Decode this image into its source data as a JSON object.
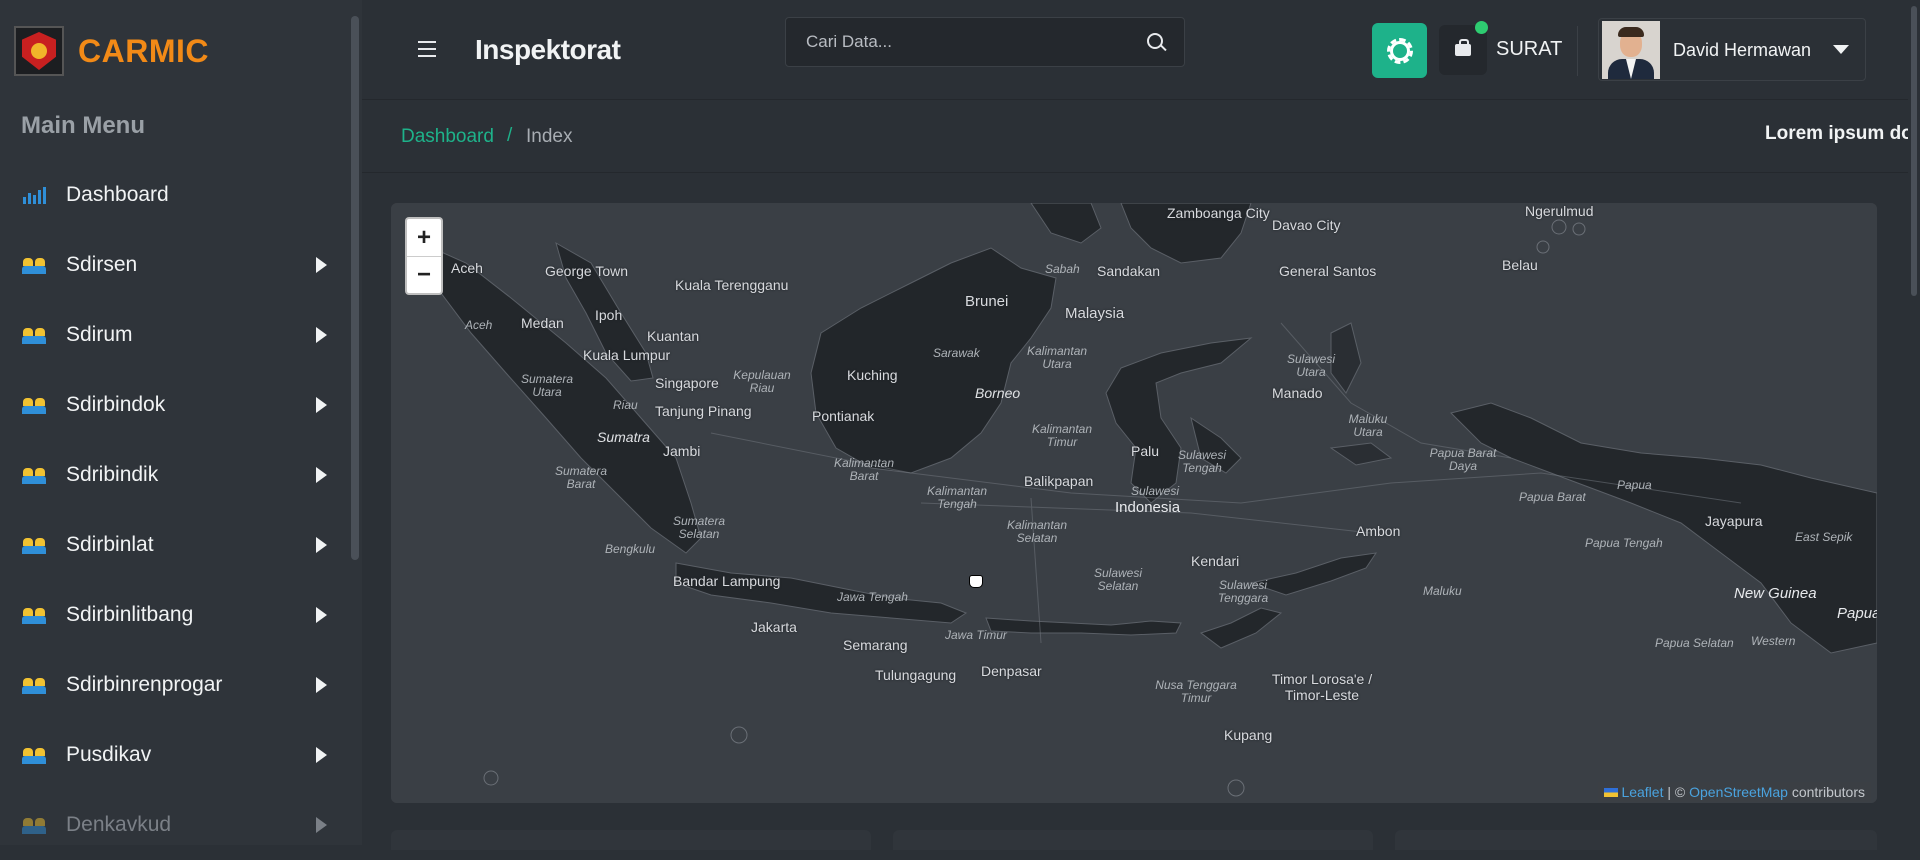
{
  "app": {
    "name": "CARMIC"
  },
  "sidebar": {
    "menu_title": "Main Menu",
    "items": [
      {
        "label": "Dashboard",
        "icon": "chart-icon",
        "has_submenu": false
      },
      {
        "label": "Sdirsen",
        "icon": "users-icon",
        "has_submenu": true
      },
      {
        "label": "Sdirum",
        "icon": "users-icon",
        "has_submenu": true
      },
      {
        "label": "Sdirbindok",
        "icon": "users-icon",
        "has_submenu": true
      },
      {
        "label": "Sdribindik",
        "icon": "users-icon",
        "has_submenu": true
      },
      {
        "label": "Sdirbinlat",
        "icon": "users-icon",
        "has_submenu": true
      },
      {
        "label": "Sdirbinlitbang",
        "icon": "users-icon",
        "has_submenu": true
      },
      {
        "label": "Sdirbinrenprogar",
        "icon": "users-icon",
        "has_submenu": true
      },
      {
        "label": "Pusdikav",
        "icon": "users-icon",
        "has_submenu": true
      },
      {
        "label": "Denkavkud",
        "icon": "users-icon",
        "has_submenu": true
      }
    ]
  },
  "header": {
    "title": "Inspektorat",
    "search_placeholder": "Cari Data...",
    "mail_label": "SURAT",
    "user_name": "David Hermawan",
    "accent_color": "#1eb28a"
  },
  "breadcrumb": {
    "link": "Dashboard",
    "separator": "/",
    "current": "Index",
    "marquee": "Lorem ipsum do"
  },
  "map": {
    "zoom_in": "+",
    "zoom_out": "−",
    "attribution": {
      "leaflet": "Leaflet",
      "sep": " | © ",
      "osm": "OpenStreetMap",
      "suffix": " contributors"
    },
    "cities": [
      "Zamboanga City",
      "Davao City",
      "Ngerulmud",
      "George Town",
      "Kuala Terengganu",
      "Sandakan",
      "General Santos",
      "Belau",
      "Brunei",
      "Malaysia",
      "Ipoh",
      "Medan",
      "Kuantan",
      "Kuala Lumpur",
      "Singapore",
      "Kuching",
      "Manado",
      "Tanjung Pinang",
      "Pontianak",
      "Jambi",
      "Palu",
      "Indonesia",
      "Balikpapan",
      "Ambon",
      "Jayapura",
      "Kendari",
      "Bandar Lampung",
      "Jakarta",
      "Semarang",
      "Tulungagung",
      "Denpasar",
      "Timor Lorosa'e / Timor-Leste",
      "Kupang",
      "New Guinea",
      "Papua",
      "Aceh"
    ],
    "regions": [
      "Sabah",
      "Sarawak",
      "Kalimantan Utara",
      "Borneo",
      "Kalimantan Timur",
      "Kalimantan Barat",
      "Kalimantan Tengah",
      "Kalimantan Selatan",
      "Sumatera Utara",
      "Riau",
      "Sumatra",
      "Sumatera Barat",
      "Sumatera Selatan",
      "Bengkulu",
      "Kepulauan Riau",
      "Sulawesi Utara",
      "Maluku Utara",
      "Sulawesi Tengah",
      "Sulawesi",
      "Sulawesi Selatan",
      "Sulawesi Tenggara",
      "Papua Barat Daya",
      "Papua Barat",
      "Papua",
      "Papua Tengah",
      "Papua Selatan",
      "East Sepik",
      "Western",
      "Maluku",
      "Jawa Tengah",
      "Jawa Timur",
      "Nusa Tenggara Timur",
      "Aceh"
    ]
  }
}
